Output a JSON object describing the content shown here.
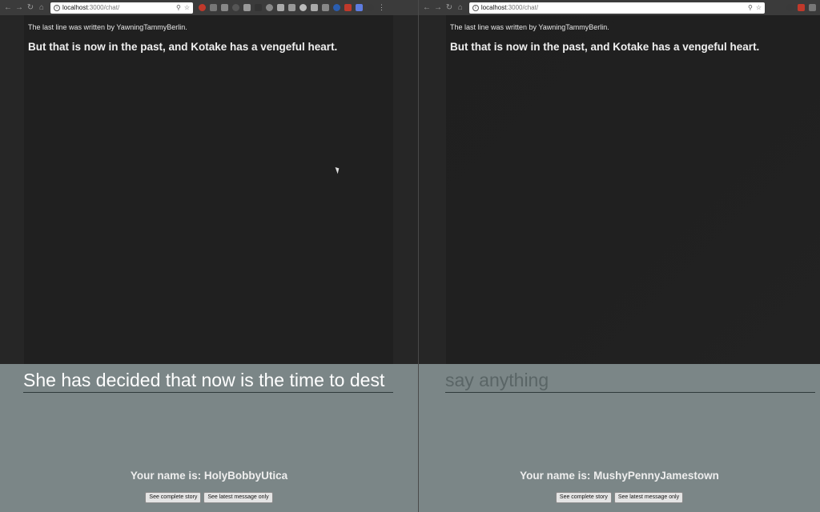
{
  "windows": [
    {
      "id": "left",
      "url_host": "localhost",
      "url_path": ":3000/chat/",
      "attribution": "The last line was written by YawningTammyBerlin.",
      "latest_line": "But that is now in the past, and Kotake has a vengeful heart.",
      "input_value": "She has decided that now is the time to dest",
      "input_placeholder": "say anything",
      "name_line": "Your name is: HolyBobbyUtica",
      "btn_complete": "See complete story",
      "btn_latest": "See latest message only",
      "extensions": [
        "#c0392b",
        "#777",
        "#888",
        "#555",
        "#999",
        "#333",
        "#888",
        "#aaa",
        "#999",
        "#bbb",
        "#aaa",
        "#888",
        "#2a5db0",
        "#c0392b",
        "#5e7ce0",
        "#3a3a3a"
      ]
    },
    {
      "id": "right",
      "url_host": "localhost",
      "url_path": ":3000/chat/",
      "attribution": "The last line was written by YawningTammyBerlin.",
      "latest_line": "But that is now in the past, and Kotake has a vengeful heart.",
      "input_value": "",
      "input_placeholder": "say anything",
      "name_line": "Your name is: MushyPennyJamestown",
      "btn_complete": "See complete story",
      "btn_latest": "See latest message only",
      "extensions": [
        "#3a3a3a",
        "#c0392b",
        "#777"
      ]
    }
  ],
  "colors": {
    "story_bg": "#202020",
    "composer_bg": "#7b8687",
    "toolbar_bg": "#3b3b3b"
  }
}
